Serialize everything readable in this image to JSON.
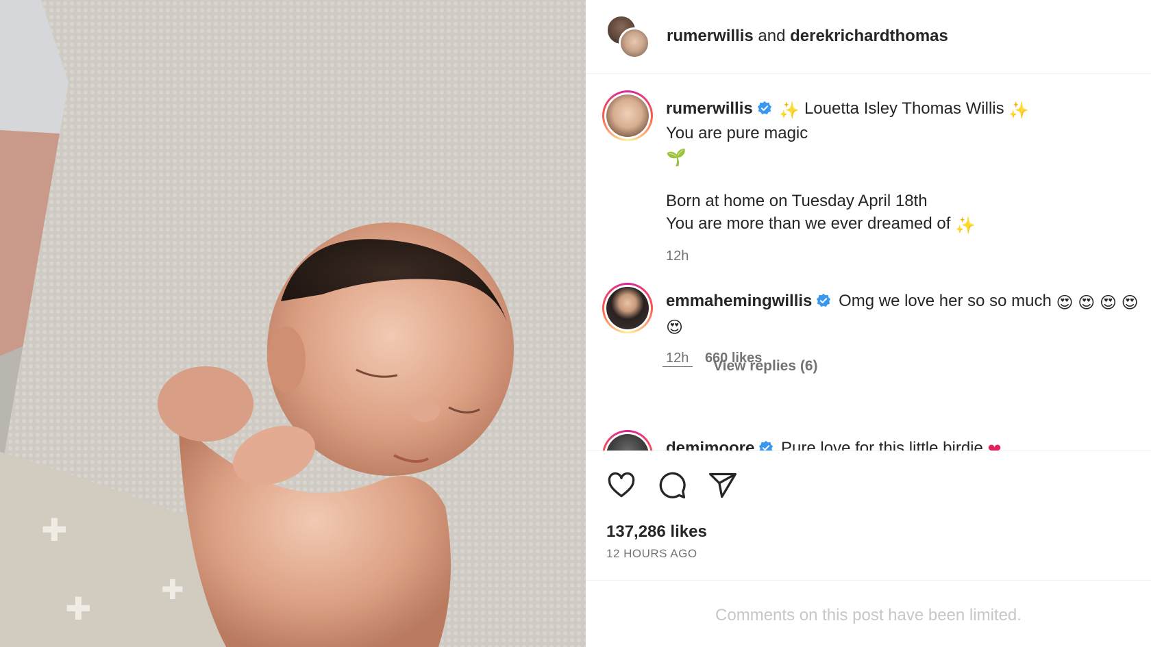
{
  "header": {
    "user1": "rumerwillis",
    "joiner": "and",
    "user2": "derekrichardthomas"
  },
  "caption": {
    "username": "rumerwillis",
    "line1": "Louetta Isley Thomas Willis",
    "line2": "You are pure magic",
    "line3": "Born at home on Tuesday April 18th",
    "line4": "You are more than we ever dreamed of",
    "time": "12h"
  },
  "comments": [
    {
      "username": "emmahemingwillis",
      "text": "Omg we love her so so much",
      "time": "12h",
      "likes": "660 likes",
      "view_replies": "View replies (6)"
    },
    {
      "username": "demimoore",
      "text": "Pure love for this little birdie"
    }
  ],
  "post": {
    "likes": "137,286 likes",
    "time_ago": "12 HOURS AGO",
    "limited_notice": "Comments on this post have been limited."
  },
  "icons": {
    "like": "heart-icon",
    "comment": "comment-bubble-icon",
    "share": "paper-plane-icon",
    "verified": "verified-badge-icon"
  },
  "colors": {
    "verified_blue": "#3897f0",
    "text": "#262626",
    "secondary": "#737373",
    "muted": "#c7c7c7"
  }
}
